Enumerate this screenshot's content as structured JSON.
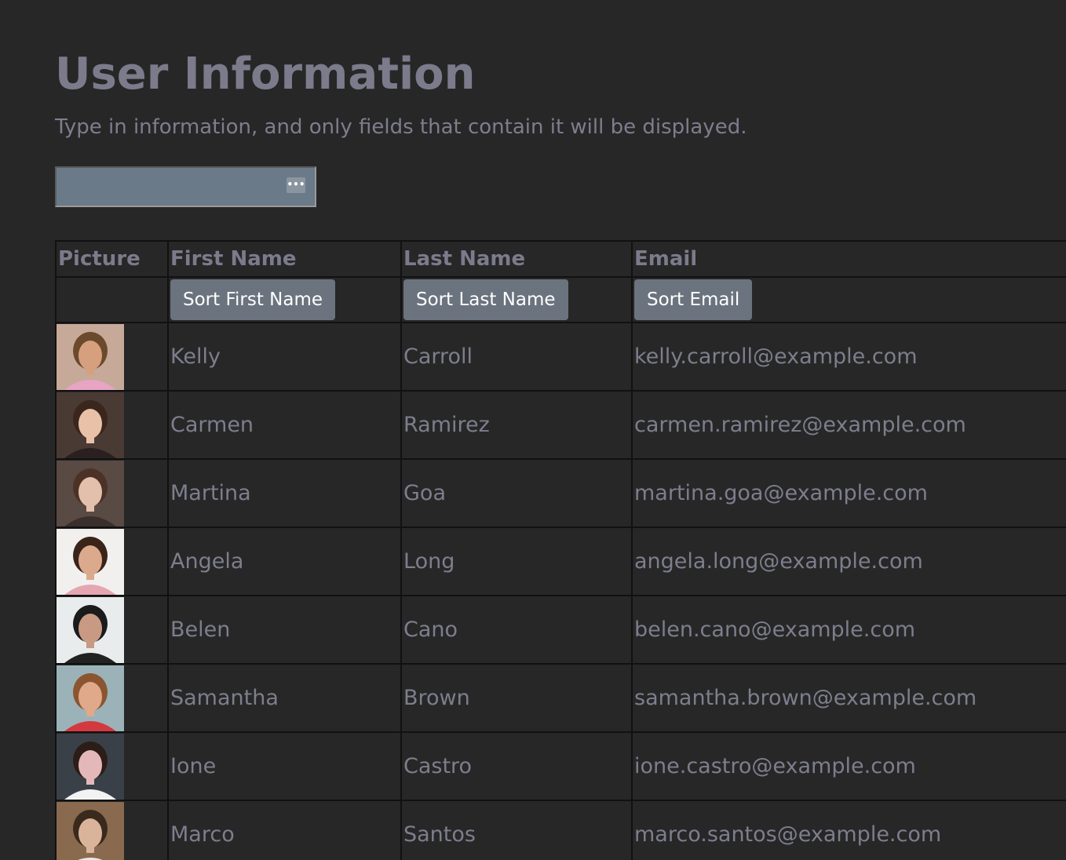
{
  "page": {
    "title": "User Information",
    "subtitle": "Type in information, and only fields that contain it will be displayed.",
    "search": {
      "value": "",
      "placeholder": "",
      "icon": "more-dots-icon",
      "icon_glyph": "•••"
    }
  },
  "table": {
    "headers": {
      "picture": "Picture",
      "first_name": "First Name",
      "last_name": "Last Name",
      "email": "Email"
    },
    "sort_buttons": {
      "first_name": "Sort First Name",
      "last_name": "Sort Last Name",
      "email": "Sort Email"
    },
    "rows": [
      {
        "first": "Kelly",
        "last": "Carroll",
        "email": "kelly.carroll@example.com",
        "avatar": {
          "bg": "#c7a99a",
          "skin": "#d6a07e",
          "hair": "#6b4a2c",
          "shirt": "#e7a5c3"
        }
      },
      {
        "first": "Carmen",
        "last": "Ramirez",
        "email": "carmen.ramirez@example.com",
        "avatar": {
          "bg": "#4a3a34",
          "skin": "#e9c1a8",
          "hair": "#3a261c",
          "shirt": "#2a2020"
        }
      },
      {
        "first": "Martina",
        "last": "Goa",
        "email": "martina.goa@example.com",
        "avatar": {
          "bg": "#5a4a44",
          "skin": "#e3c0ab",
          "hair": "#4c3226",
          "shirt": "#3a2f2c"
        }
      },
      {
        "first": "Angela",
        "last": "Long",
        "email": "angela.long@example.com",
        "avatar": {
          "bg": "#f2f0ee",
          "skin": "#dba98b",
          "hair": "#3a2419",
          "shirt": "#e5a6b2"
        }
      },
      {
        "first": "Belen",
        "last": "Cano",
        "email": "belen.cano@example.com",
        "avatar": {
          "bg": "#e9ecec",
          "skin": "#c89a84",
          "hair": "#1b1b1b",
          "shirt": "#222222"
        }
      },
      {
        "first": "Samantha",
        "last": "Brown",
        "email": "samantha.brown@example.com",
        "avatar": {
          "bg": "#9bb3b8",
          "skin": "#e0a989",
          "hair": "#8a5530",
          "shirt": "#d33a3f"
        }
      },
      {
        "first": "Ione",
        "last": "Castro",
        "email": "ione.castro@example.com",
        "avatar": {
          "bg": "#3a4048",
          "skin": "#e4b7b9",
          "hair": "#2b1d17",
          "shirt": "#f2f2f2"
        }
      },
      {
        "first": "Marco",
        "last": "Santos",
        "email": "marco.santos@example.com",
        "avatar": {
          "bg": "#8a6a4e",
          "skin": "#d9b49a",
          "hair": "#3a2a1e",
          "shirt": "#e8e8e8"
        }
      }
    ]
  }
}
